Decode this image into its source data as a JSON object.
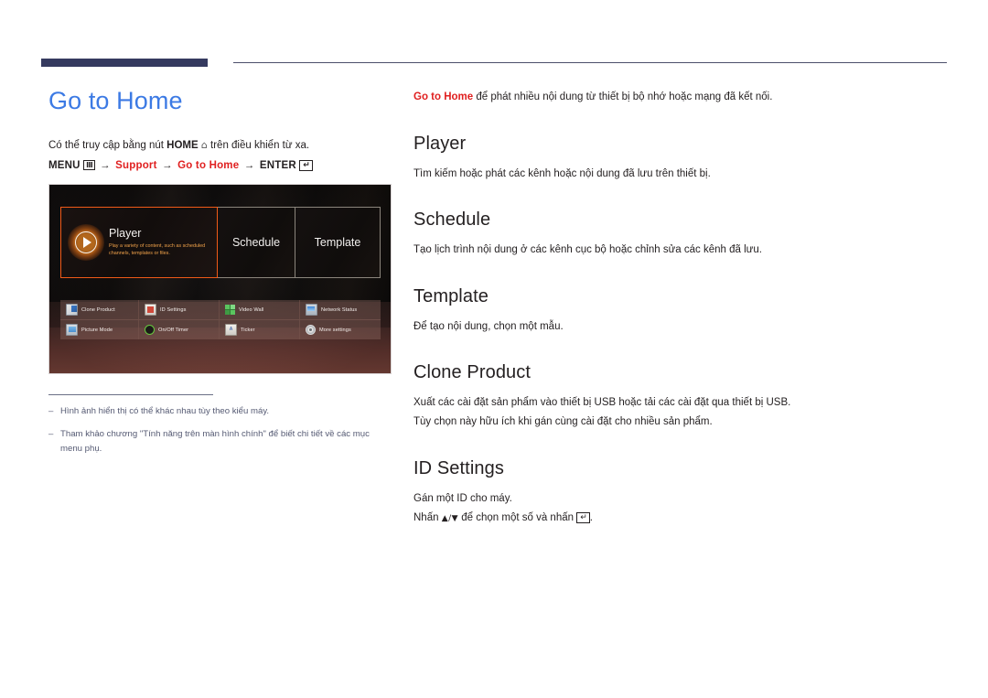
{
  "header": {
    "rule_color": "#353a5f"
  },
  "left": {
    "title": "Go to Home",
    "intro_prefix": "Có thể truy cập bằng nút ",
    "intro_home": "HOME",
    "intro_suffix": " trên điều khiển từ xa.",
    "menu_path": {
      "menu": "MENU",
      "support": "Support",
      "go_to_home": "Go to Home",
      "enter": "ENTER",
      "arrow": "→"
    },
    "notes": [
      {
        "dash": "–",
        "text": "Hình ảnh hiển thị có thể khác nhau tùy theo kiểu máy."
      },
      {
        "dash": "–",
        "text": "Tham khảo chương \"Tính năng trên màn hình chính\" để biết chi tiết về các mục menu phụ."
      }
    ]
  },
  "tv_screen": {
    "tiles": [
      {
        "label": "Player",
        "description": "Play a variety of content, such as scheduled channels, templates or files.",
        "selected": true,
        "border_color": "#f05a18"
      },
      {
        "label": "Schedule",
        "selected": false,
        "border_color": "#8b857c"
      },
      {
        "label": "Template",
        "selected": false,
        "border_color": "#8b857c"
      }
    ],
    "grid_row_1": [
      {
        "label": "Clone Product",
        "icon": "clone-product-icon"
      },
      {
        "label": "ID Settings",
        "icon": "id-settings-icon"
      },
      {
        "label": "Video Wall",
        "icon": "video-wall-icon"
      },
      {
        "label": "Network Status",
        "icon": "network-status-icon"
      }
    ],
    "grid_row_2": [
      {
        "label": "Picture Mode",
        "icon": "picture-mode-icon"
      },
      {
        "label": "On/Off Timer",
        "icon": "onoff-timer-icon"
      },
      {
        "label": "Ticker",
        "icon": "ticker-icon"
      },
      {
        "label": "More settings",
        "icon": "more-settings-icon"
      }
    ]
  },
  "right": {
    "intro_red": "Go to Home",
    "intro_rest": " để phát nhiều nội dung từ thiết bị bộ nhớ hoặc mạng đã kết nối.",
    "sections": [
      {
        "heading": "Player",
        "lines": [
          "Tìm kiếm hoặc phát các kênh hoặc nội dung đã lưu trên thiết bị."
        ]
      },
      {
        "heading": "Schedule",
        "lines": [
          "Tạo lịch trình nội dung ở các kênh cục bộ hoặc chỉnh sửa các kênh đã lưu."
        ]
      },
      {
        "heading": "Template",
        "lines": [
          "Để tạo nội dung, chọn một mẫu."
        ]
      },
      {
        "heading": "Clone Product",
        "lines": [
          "Xuất các cài đặt sản phẩm vào thiết bị USB hoặc tải các cài đặt qua thiết bị USB.",
          "Tùy chọn này hữu ích khi gán cùng cài đặt cho nhiều sản phẩm."
        ]
      },
      {
        "heading": "ID Settings",
        "lines": [
          "Gán một ID cho máy."
        ],
        "last_line_prefix": "Nhấn ",
        "last_line_arrows": "▲/▼",
        "last_line_mid": " để chọn một số và nhấn ",
        "last_line_suffix": "."
      }
    ]
  }
}
